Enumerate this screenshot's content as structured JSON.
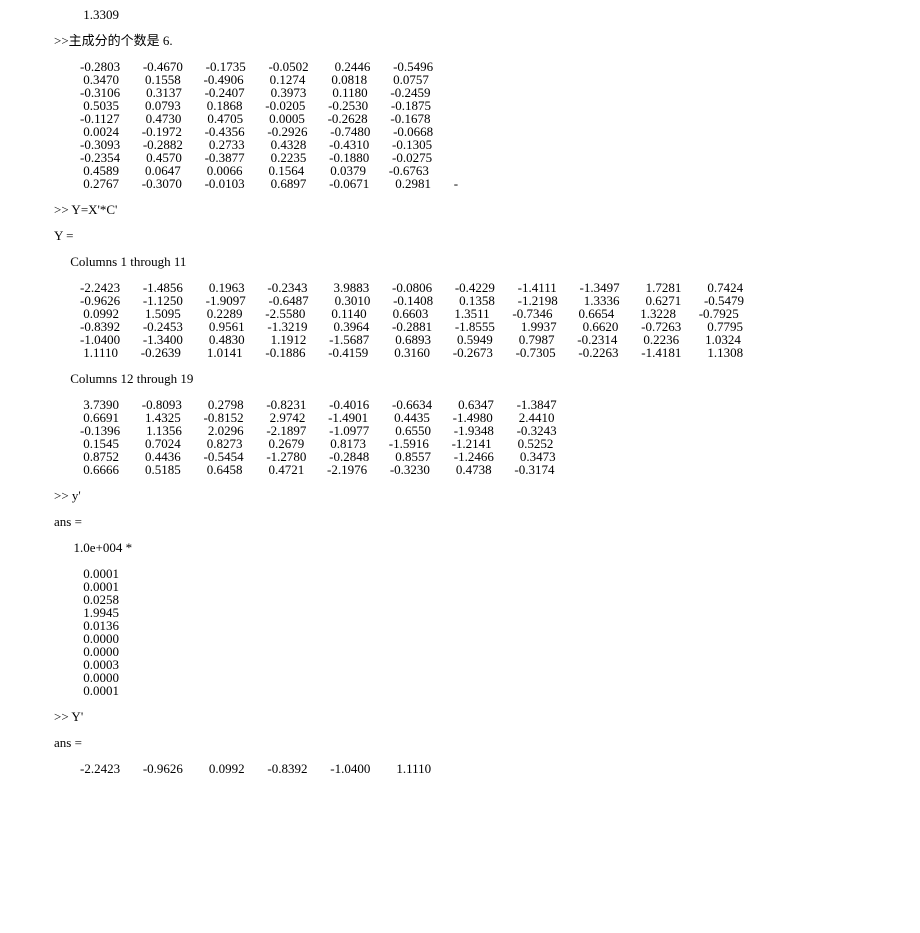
{
  "topval": "         1.3309",
  "pca_label": ">>主成分的个数是 6.",
  "mat1": [
    "        -0.2803       -0.4670       -0.1735       -0.0502        0.2446       -0.5496",
    "         0.3470        0.1558       -0.4906        0.1274        0.0818        0.0757",
    "        -0.3106        0.3137       -0.2407        0.3973        0.1180       -0.2459",
    "         0.5035        0.0793        0.1868       -0.0205       -0.2530       -0.1875",
    "        -0.1127        0.4730        0.4705        0.0005       -0.2628       -0.1678",
    "         0.0024       -0.1972       -0.4356       -0.2926       -0.7480       -0.0668",
    "        -0.3093       -0.2882        0.2733        0.4328       -0.4310       -0.1305",
    "        -0.2354        0.4570       -0.3877        0.2235       -0.1880       -0.0275",
    "         0.4589        0.0647        0.0066        0.1564        0.0379       -0.6763",
    "         0.2767       -0.3070       -0.0103        0.6897       -0.0671        0.2981       -"
  ],
  "cmd1": ">> Y=X'*C'",
  "Yeq": "Y =",
  "cols1_label": "     Columns 1 through 11",
  "mat2": [
    "        -2.2423       -1.4856        0.1963       -0.2343        3.9883       -0.0806       -0.4229       -1.4111       -1.3497        1.7281        0.7424",
    "        -0.9626       -1.1250       -1.9097       -0.6487        0.3010       -0.1408        0.1358       -1.2198        1.3336        0.6271       -0.5479",
    "         0.0992        1.5095        0.2289       -2.5580        0.1140        0.6603        1.3511       -0.7346        0.6654        1.3228       -0.7925",
    "        -0.8392       -0.2453        0.9561       -1.3219        0.3964       -0.2881       -1.8555        1.9937        0.6620       -0.7263        0.7795",
    "        -1.0400       -1.3400        0.4830        1.1912       -1.5687        0.6893        0.5949        0.7987       -0.2314        0.2236        1.0324",
    "         1.1110       -0.2639        1.0141       -0.1886       -0.4159        0.3160       -0.2673       -0.7305       -0.2263       -1.4181        1.1308"
  ],
  "cols2_label": "     Columns 12 through 19",
  "mat3": [
    "         3.7390       -0.8093        0.2798       -0.8231       -0.4016       -0.6634        0.6347       -1.3847",
    "         0.6691        1.4325       -0.8152        2.9742       -1.4901        0.4435       -1.4980        2.4410",
    "        -0.1396        1.1356        2.0296       -2.1897       -1.0977        0.6550       -1.9348       -0.3243",
    "         0.1545        0.7024        0.8273        0.2679        0.8173       -1.5916       -1.2141        0.5252",
    "         0.8752        0.4436       -0.5454       -1.2780       -0.2848        0.8557       -1.2466        0.3473",
    "         0.6666        0.5185        0.6458        0.4721       -2.1976       -0.3230        0.4738       -0.3174"
  ],
  "cmd2": ">> y'",
  "ans1": "ans =",
  "scale": "      1.0e+004 *",
  "vec1": [
    "         0.0001",
    "         0.0001",
    "         0.0258",
    "         1.9945",
    "         0.0136",
    "         0.0000",
    "         0.0000",
    "         0.0003",
    "         0.0000",
    "         0.0001"
  ],
  "cmd3": ">> Y'",
  "ans2": "ans =",
  "vec2": "        -2.2423       -0.9626        0.0992       -0.8392       -1.0400        1.1110"
}
